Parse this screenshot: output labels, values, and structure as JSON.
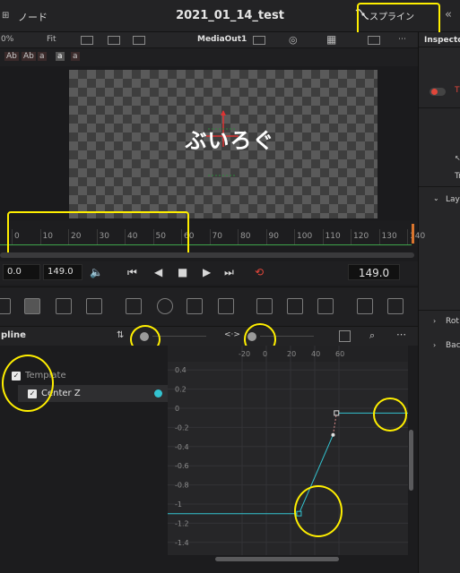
{
  "titlebar": {
    "node_label": "ノード",
    "title": "2021_01_14_test",
    "spline_label": "スプライン",
    "node_icon": "node-grid-icon",
    "spline_icon": "spline-curve-icon"
  },
  "viewer_toolbar": {
    "zoom_left": "0%",
    "fit": "Fit",
    "output": "MediaOut1"
  },
  "text_tools": [
    "Ab",
    "Ab",
    "a",
    "a",
    "a"
  ],
  "viewer": {
    "overlay_text": "ぶいろぐ"
  },
  "ruler": {
    "ticks": [
      "0",
      "10",
      "20",
      "30",
      "40",
      "50",
      "60",
      "70",
      "80",
      "90",
      "100",
      "110",
      "120",
      "130",
      "140"
    ]
  },
  "transport": {
    "start": "0.0",
    "end": "149.0",
    "current": "149.0"
  },
  "spline": {
    "panel_label": "pline",
    "tree": [
      {
        "label": "Template",
        "checked": true
      },
      {
        "label": "Center Z",
        "checked": true
      }
    ],
    "x_ticks": [
      "-20",
      "0",
      "20",
      "40",
      "60"
    ],
    "y_ticks": [
      "0.4",
      "0.2",
      "0",
      "-0.2",
      "-0.4",
      "-0.6",
      "-0.8",
      "-1",
      "-1.2",
      "-1.4"
    ],
    "curve_color": "#33c3d0"
  },
  "inspector": {
    "label": "Inspecto",
    "rows": [
      "T",
      "Tr",
      "Lay",
      "Rot",
      "Bac"
    ]
  },
  "colors": {
    "accent": "#ffef00",
    "loop": "#e0463a",
    "timeline_green": "#3fa34a"
  }
}
